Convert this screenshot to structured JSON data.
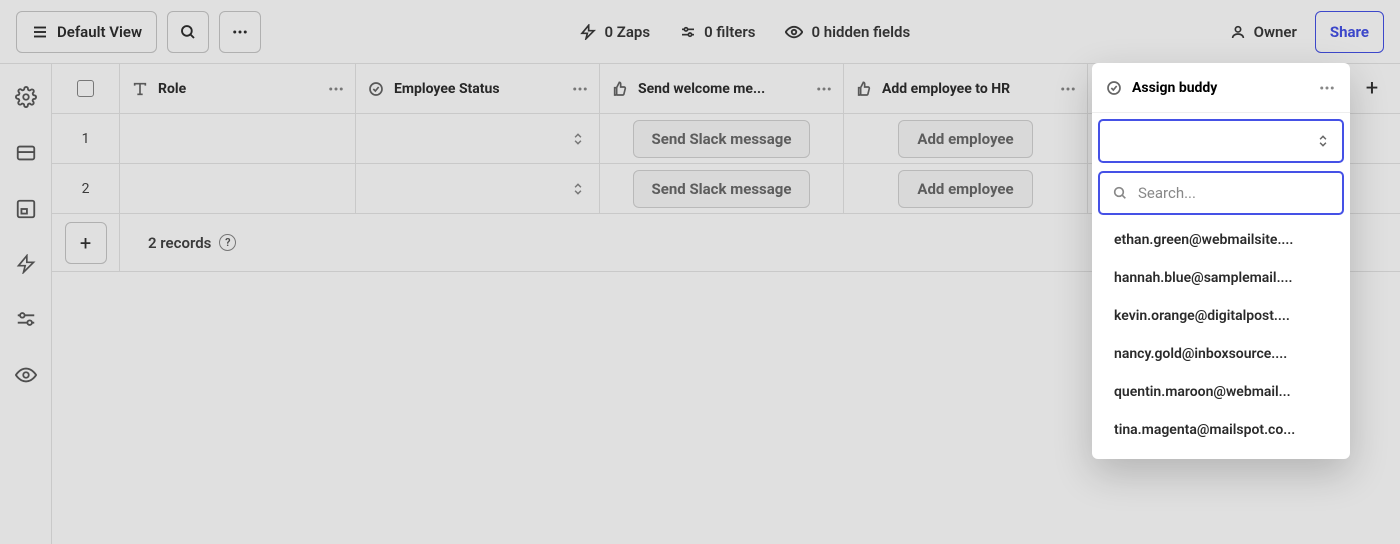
{
  "toolbar": {
    "view_label": "Default View",
    "zaps": "0 Zaps",
    "filters": "0 filters",
    "hidden_fields": "0 hidden fields",
    "owner": "Owner",
    "share": "Share"
  },
  "columns": {
    "role": "Role",
    "employee_status": "Employee Status",
    "send_welcome": "Send welcome me...",
    "add_employee_hr": "Add employee to HR",
    "assign_buddy": "Assign buddy"
  },
  "rows": [
    {
      "num": "1",
      "welcome_btn": "Send Slack message",
      "add_emp_btn": "Add employee"
    },
    {
      "num": "2",
      "welcome_btn": "Send Slack message",
      "add_emp_btn": "Add employee"
    }
  ],
  "footer": {
    "records": "2 records"
  },
  "popover": {
    "title": "Assign buddy",
    "search_placeholder": "Search...",
    "options": [
      "ethan.green@webmailsite....",
      "hannah.blue@samplemail....",
      "kevin.orange@digitalpost....",
      "nancy.gold@inboxsource....",
      "quentin.maroon@webmail...",
      "tina.magenta@mailspot.co..."
    ]
  }
}
